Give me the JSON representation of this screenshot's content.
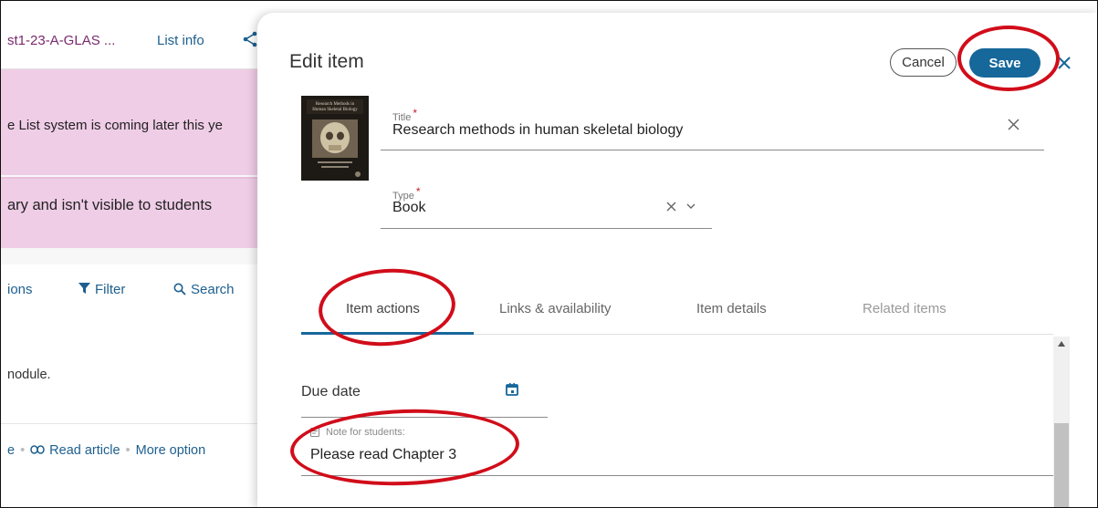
{
  "background": {
    "list_name": "st1-23-A-GLAS ...",
    "list_info": "List info",
    "banner_1": "e List system is coming later this ye",
    "banner_2": "ary and isn't visible to students",
    "toolbar": {
      "options_partial": "ions",
      "filter": "Filter",
      "search": "Search"
    },
    "module_text": "nodule.",
    "actions": {
      "partial": "e",
      "read_article": "Read article",
      "more_options": "More option"
    }
  },
  "panel": {
    "title": "Edit item",
    "cancel_label": "Cancel",
    "save_label": "Save"
  },
  "item": {
    "title_label": "Title",
    "title_value": "Research methods in human skeletal biology",
    "type_label": "Type",
    "type_value": "Book",
    "required_marker": "*",
    "cover_text": "Research Methods in Human Skeletal Biology"
  },
  "tabs": [
    {
      "label": "Item actions",
      "active": true
    },
    {
      "label": "Links & availability",
      "active": false
    },
    {
      "label": "Item details",
      "active": false
    },
    {
      "label": "Related items",
      "active": false
    }
  ],
  "item_actions": {
    "due_date_label": "Due date",
    "note_label": "Note for students:",
    "note_value": "Please read Chapter 3"
  },
  "colors": {
    "accent": "#16679a",
    "annotation_red": "#d10d1a",
    "banner_pink": "#efcde6",
    "list_name_purple": "#7a2a6e"
  },
  "icons": {
    "share": "share-icon",
    "filter": "filter-icon",
    "search": "search-icon",
    "link": "link-icon",
    "close": "close-icon",
    "clear": "clear-icon",
    "chevron": "chevron-down-icon",
    "calendar": "calendar-icon",
    "note": "note-icon"
  }
}
